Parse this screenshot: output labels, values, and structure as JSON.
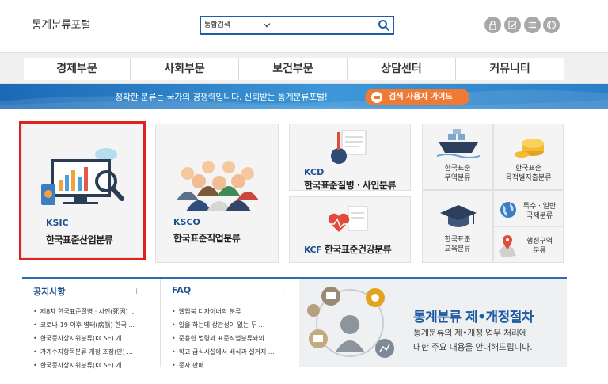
{
  "header": {
    "logo": "통계분류포털",
    "search": {
      "selected": "통합검색",
      "placeholder": ""
    },
    "util_icons": [
      "lock-icon",
      "edit-icon",
      "list-icon",
      "globe-icon"
    ]
  },
  "gnb": {
    "items": [
      "경제부문",
      "사회부문",
      "보건부문",
      "상담센터",
      "커뮤니티"
    ]
  },
  "banner": {
    "text": "정확한 분류는 국가의 경쟁력입니다. 신뢰받는 통계분류포털!",
    "button_label": "검색 사용자 가이드"
  },
  "cards": {
    "ksic": {
      "code": "KSIC",
      "name": "한국표준산업분류"
    },
    "ksco": {
      "code": "KSCO",
      "name": "한국표준직업분류"
    },
    "kcd": {
      "code": "KCD",
      "name": "한국표준질병ㆍ사인분류"
    },
    "kcf": {
      "code": "KCF",
      "name": "한국표준건강분류"
    }
  },
  "tiles": [
    {
      "line1": "한국표준",
      "line2": "무역분류"
    },
    {
      "line1": "한국표준",
      "line2": "목적별지출분류"
    },
    {
      "line1": "한국표준",
      "line2": "교육분류"
    },
    {
      "line1": "특수ㆍ일반",
      "line2": "국제분류"
    },
    {
      "line1": "행정구역",
      "line2": "분류"
    }
  ],
  "notice": {
    "title": "공지사항",
    "items": [
      "제8차 한국표준질병ㆍ사인(死因) ...",
      "코로나-19 이후 병태(病態) 한국 ...",
      "한국종사상지위분류(KCSE) 개 ...",
      "가계수지항목분류 개정 조정(안) ...",
      "한국종사상지위분류(KCSE) 개 ..."
    ]
  },
  "faq": {
    "title": "FAQ",
    "items": [
      "웹업북 디자이너의 분류",
      "일을 하는데 상관성이 없는 두 ...",
      "준용한 법령과 표준직업분류와의 ...",
      "학교 급식시설에서 배식과 설거지 ...",
      "종자 판매"
    ]
  },
  "procedure": {
    "title": "통계분류 제•개정절차",
    "desc_line1": "통계분류의 제•개정 업무 처리에",
    "desc_line2": "대한 주요 내용을 안내해드립니다."
  },
  "colors": {
    "brand_blue": "#1d4f8f",
    "banner_blue": "#2a7ec8",
    "highlight_red": "#e0221f",
    "guide_orange": "#f07a33"
  }
}
